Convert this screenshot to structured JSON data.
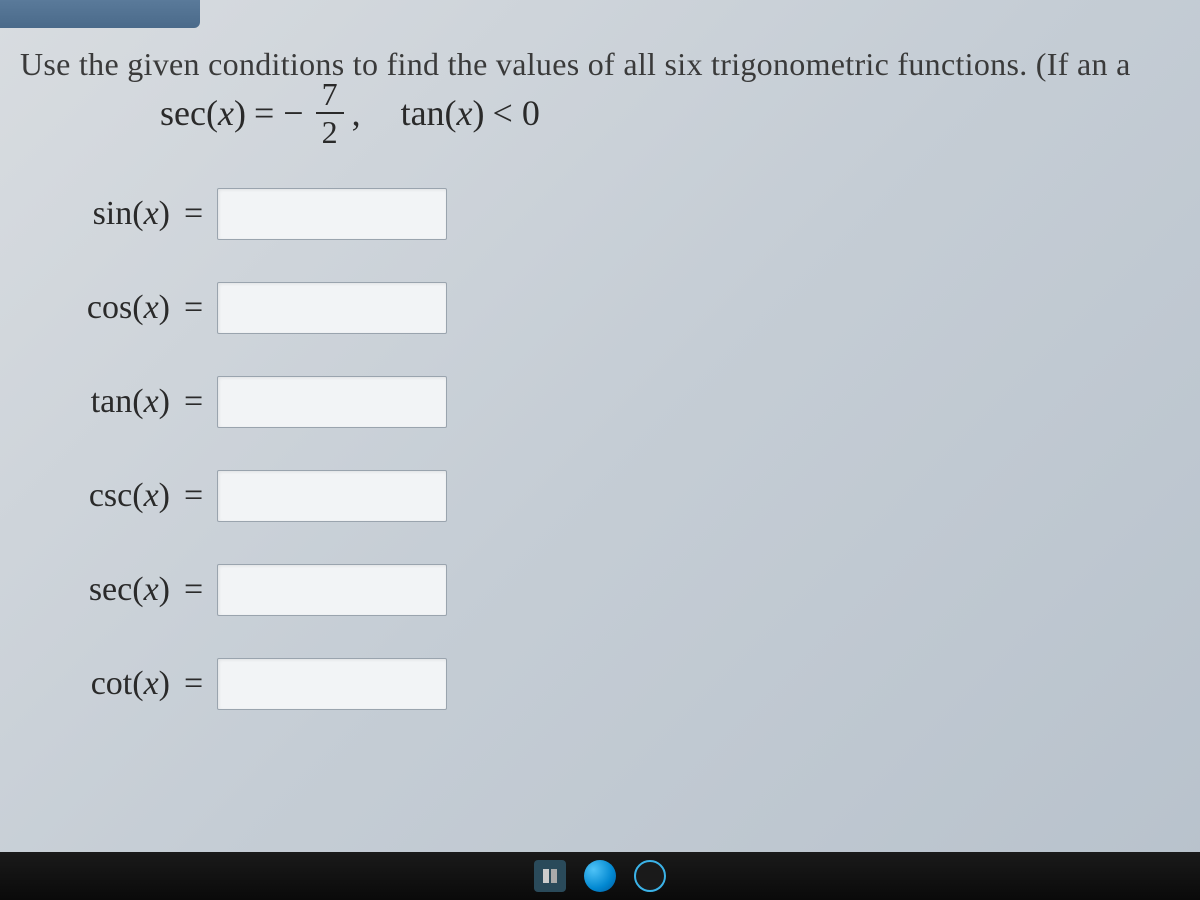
{
  "instruction": "Use the given conditions to find the values of all six trigonometric functions. (If an a",
  "given": {
    "sec_label": "sec",
    "var": "x",
    "equals": "= −",
    "frac_num": "7",
    "frac_den": "2",
    "comma": ",",
    "tan_label": "tan",
    "tan_cond": "< 0"
  },
  "rows": [
    {
      "label": "sin",
      "var": "x"
    },
    {
      "label": "cos",
      "var": "x"
    },
    {
      "label": "tan",
      "var": "x"
    },
    {
      "label": "csc",
      "var": "x"
    },
    {
      "label": "sec",
      "var": "x"
    },
    {
      "label": "cot",
      "var": "x"
    }
  ],
  "equals_sign": "="
}
